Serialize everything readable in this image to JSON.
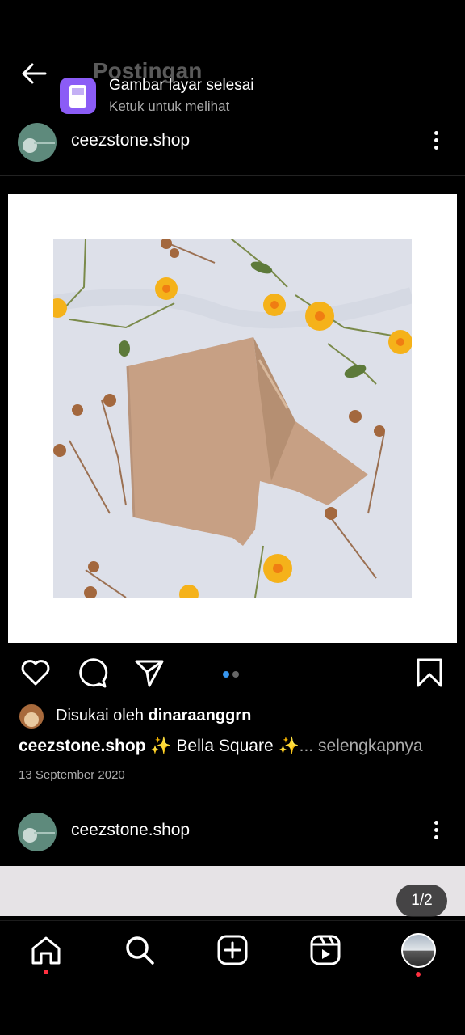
{
  "screen": {
    "title": "Postingan"
  },
  "toast": {
    "title": "Gambar layar selesai",
    "subtitle": "Ketuk untuk melihat"
  },
  "posts": [
    {
      "username": "ceezstone.shop",
      "liked_by_prefix": "Disukai oleh",
      "liked_by_user": "dinaraanggrn",
      "caption_user": "ceezstone.shop",
      "caption_text": "Bella Square",
      "caption_more": "... selengkapnya",
      "date": "13 September 2020",
      "carousel_dots": 2,
      "carousel_active": 1
    },
    {
      "username": "ceezstone.shop",
      "carousel_counter": "1/2"
    }
  ],
  "icons": {
    "back": "arrow-left-icon",
    "like": "heart-icon",
    "comment": "comment-icon",
    "share": "send-icon",
    "save": "bookmark-icon",
    "home": "home-icon",
    "search": "search-icon",
    "create": "plus-square-icon",
    "reels": "reels-icon",
    "profile": "profile-avatar"
  },
  "colors": {
    "accent_notification": "#ff3040",
    "toast_icon": "#8b5cf6",
    "carousel_active": "#3897f0"
  }
}
